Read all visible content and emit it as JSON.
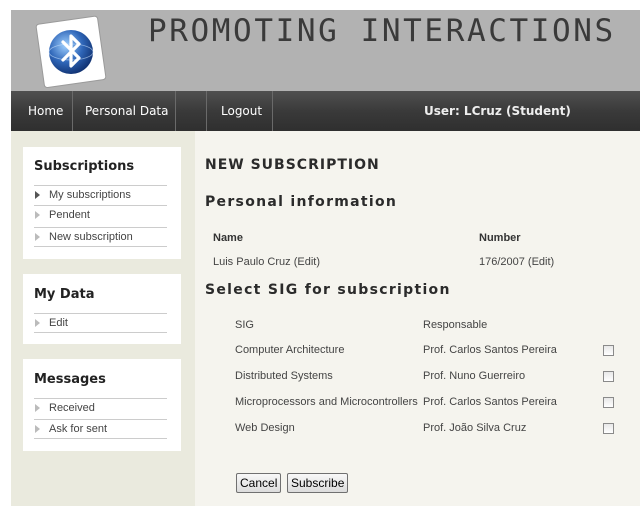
{
  "header": {
    "title": "PROMOTING INTERACTIONS",
    "logo_icon": "bluetooth-globe-logo-icon"
  },
  "nav": {
    "items": [
      "Home",
      "Personal Data",
      "Logout"
    ],
    "user": "User: LCruz (Student)"
  },
  "sidebar": {
    "subscriptions": {
      "title": "Subscriptions",
      "items": [
        "My subscriptions",
        "Pendent",
        "New subscription"
      ]
    },
    "my_data": {
      "title": "My Data",
      "items": [
        "Edit"
      ]
    },
    "messages": {
      "title": "Messages",
      "items": [
        "Received",
        "Ask for sent"
      ]
    }
  },
  "main": {
    "page_title": "NEW SUBSCRIPTION",
    "personal": {
      "heading": "Personal information",
      "name_label": "Name",
      "number_label": "Number",
      "name_value": "Luis Paulo Cruz (Edit)",
      "number_value": "176/2007 (Edit)"
    },
    "sig": {
      "heading": "Select SIG for subscription",
      "col_sig": "SIG",
      "col_resp": "Responsable",
      "rows": [
        {
          "sig": "Computer Architecture",
          "resp": "Prof. Carlos Santos Pereira"
        },
        {
          "sig": "Distributed Systems",
          "resp": "Prof. Nuno Guerreiro"
        },
        {
          "sig": "Microprocessors and Microcontrollers",
          "resp": "Prof. Carlos Santos Pereira"
        },
        {
          "sig": "Web Design",
          "resp": "Prof. João Silva Cruz"
        }
      ]
    },
    "buttons": {
      "cancel": "Cancel",
      "subscribe": "Subscribe"
    }
  },
  "colors": {
    "header_bg": "#b2b2b2",
    "nav_bg": "#3a3a3a",
    "sidebar_bg": "#eaeade",
    "content_bg": "#f5f4ee",
    "logo_blue": "#2f66b8"
  }
}
